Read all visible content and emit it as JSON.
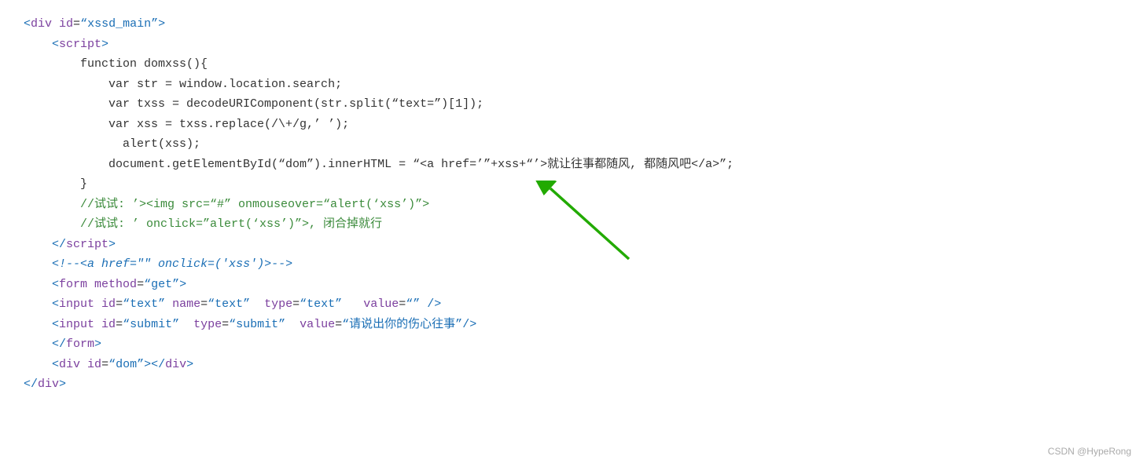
{
  "watermark": "CSDN @HypeRong",
  "lines": [
    {
      "id": "l1",
      "parts": [
        {
          "text": "<",
          "cls": "blue"
        },
        {
          "text": "div",
          "cls": "purple"
        },
        {
          "text": " id",
          "cls": "purple"
        },
        {
          "text": "=",
          "cls": "black"
        },
        {
          "text": "“xssd_main”",
          "cls": "blue"
        },
        {
          "text": ">",
          "cls": "blue"
        }
      ]
    },
    {
      "id": "l2",
      "parts": [
        {
          "text": "    ",
          "cls": "black"
        },
        {
          "text": "<",
          "cls": "blue"
        },
        {
          "text": "script",
          "cls": "purple"
        },
        {
          "text": ">",
          "cls": "blue"
        }
      ]
    },
    {
      "id": "l3",
      "parts": [
        {
          "text": "        function domxss(){",
          "cls": "black"
        }
      ]
    },
    {
      "id": "l4",
      "parts": [
        {
          "text": "            var str = window.location.search;",
          "cls": "black"
        }
      ]
    },
    {
      "id": "l5",
      "parts": [
        {
          "text": "            var txss = decodeURIComponent(str.split(“text=”)[1]);",
          "cls": "black"
        }
      ]
    },
    {
      "id": "l6",
      "parts": [
        {
          "text": "            var xss = txss.replace(/\\+/g,’ ’);",
          "cls": "black"
        }
      ]
    },
    {
      "id": "l7",
      "parts": [
        {
          "text": "              alert(xss);",
          "cls": "black"
        }
      ]
    },
    {
      "id": "l8",
      "parts": [
        {
          "text": "",
          "cls": "black"
        }
      ]
    },
    {
      "id": "l9",
      "parts": [
        {
          "text": "            document.getElementById(“dom”).innerHTML = “<a href=’”+xss+“’>就让往事都随风, 都随风吧</a>”;",
          "cls": "black"
        }
      ]
    },
    {
      "id": "l10",
      "parts": [
        {
          "text": "        }",
          "cls": "black"
        }
      ]
    },
    {
      "id": "l11",
      "parts": [
        {
          "text": "        //试试: ’><img src=“#” onmouseover=“alert(‘xss’)”>",
          "cls": "comment"
        }
      ]
    },
    {
      "id": "l12",
      "parts": [
        {
          "text": "        //试试: ’ onclick=”alert(‘xss’)”>, 闭合掉就行",
          "cls": "comment"
        }
      ]
    },
    {
      "id": "l13",
      "parts": [
        {
          "text": "    ",
          "cls": "black"
        },
        {
          "text": "</",
          "cls": "blue"
        },
        {
          "text": "script",
          "cls": "purple"
        },
        {
          "text": ">",
          "cls": "blue"
        }
      ]
    },
    {
      "id": "l14",
      "parts": [
        {
          "text": "    ",
          "cls": "black"
        },
        {
          "text": "<!--",
          "cls": "green-italic"
        },
        {
          "text": "<a href=\"\" onclick=('xss')>",
          "cls": "green-italic"
        },
        {
          "text": "-->",
          "cls": "green-italic"
        }
      ]
    },
    {
      "id": "l15",
      "parts": [
        {
          "text": "    ",
          "cls": "black"
        },
        {
          "text": "<",
          "cls": "blue"
        },
        {
          "text": "form",
          "cls": "purple"
        },
        {
          "text": " method",
          "cls": "purple"
        },
        {
          "text": "=",
          "cls": "black"
        },
        {
          "text": "“get”",
          "cls": "blue"
        },
        {
          "text": ">",
          "cls": "blue"
        }
      ]
    },
    {
      "id": "l16",
      "parts": [
        {
          "text": "    ",
          "cls": "black"
        },
        {
          "text": "<",
          "cls": "blue"
        },
        {
          "text": "input",
          "cls": "purple"
        },
        {
          "text": " id",
          "cls": "purple"
        },
        {
          "text": "=",
          "cls": "black"
        },
        {
          "text": "“text”",
          "cls": "blue"
        },
        {
          "text": " name",
          "cls": "purple"
        },
        {
          "text": "=",
          "cls": "black"
        },
        {
          "text": "“text”",
          "cls": "blue"
        },
        {
          "text": "  type",
          "cls": "purple"
        },
        {
          "text": "=",
          "cls": "black"
        },
        {
          "text": "“text”",
          "cls": "blue"
        },
        {
          "text": "   value",
          "cls": "purple"
        },
        {
          "text": "=",
          "cls": "black"
        },
        {
          "text": "“”",
          "cls": "blue"
        },
        {
          "text": " />",
          "cls": "blue"
        }
      ]
    },
    {
      "id": "l17",
      "parts": [
        {
          "text": "    ",
          "cls": "black"
        },
        {
          "text": "<",
          "cls": "blue"
        },
        {
          "text": "input",
          "cls": "purple"
        },
        {
          "text": " id",
          "cls": "purple"
        },
        {
          "text": "=",
          "cls": "black"
        },
        {
          "text": "“submit”",
          "cls": "blue"
        },
        {
          "text": "  type",
          "cls": "purple"
        },
        {
          "text": "=",
          "cls": "black"
        },
        {
          "text": "“submit”",
          "cls": "blue"
        },
        {
          "text": "  value",
          "cls": "purple"
        },
        {
          "text": "=",
          "cls": "black"
        },
        {
          "text": "“请说出你的伤心往事”",
          "cls": "blue"
        },
        {
          "text": "/>",
          "cls": "blue"
        }
      ]
    },
    {
      "id": "l18",
      "parts": [
        {
          "text": "    ",
          "cls": "black"
        },
        {
          "text": "</",
          "cls": "blue"
        },
        {
          "text": "form",
          "cls": "purple"
        },
        {
          "text": ">",
          "cls": "blue"
        }
      ]
    },
    {
      "id": "l19",
      "parts": [
        {
          "text": "    ",
          "cls": "black"
        },
        {
          "text": "<",
          "cls": "blue"
        },
        {
          "text": "div",
          "cls": "purple"
        },
        {
          "text": " id",
          "cls": "purple"
        },
        {
          "text": "=",
          "cls": "black"
        },
        {
          "text": "“dom”",
          "cls": "blue"
        },
        {
          "text": "></",
          "cls": "blue"
        },
        {
          "text": "div",
          "cls": "purple"
        },
        {
          "text": ">",
          "cls": "blue"
        }
      ]
    },
    {
      "id": "l20",
      "parts": [
        {
          "text": "</",
          "cls": "blue"
        },
        {
          "text": "div",
          "cls": "purple"
        },
        {
          "text": ">",
          "cls": "blue"
        }
      ]
    }
  ]
}
